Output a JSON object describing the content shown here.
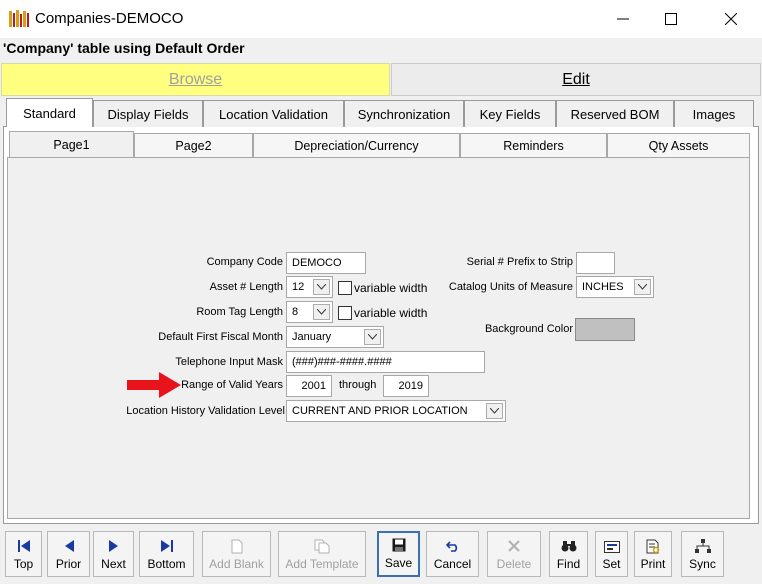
{
  "window": {
    "title": "Companies-DEMOCO",
    "minimize_icon": "minimize-icon",
    "maximize_icon": "maximize-icon",
    "close_icon": "close-icon"
  },
  "header": {
    "table_title": "'Company' table using Default Order"
  },
  "modes": {
    "browse": "Browse",
    "edit": "Edit"
  },
  "tabs": [
    "Standard",
    "Display Fields",
    "Location Validation",
    "Synchronization",
    "Key Fields",
    "Reserved BOM",
    "Images"
  ],
  "subtabs": [
    "Page1",
    "Page2",
    "Depreciation/Currency",
    "Reminders",
    "Qty Assets"
  ],
  "form": {
    "company_code": {
      "label": "Company Code",
      "value": "DEMOCO"
    },
    "asset_length": {
      "label": "Asset # Length",
      "value": "12",
      "checkbox_label": "variable width"
    },
    "room_tag_length": {
      "label": "Room Tag Length",
      "value": "8",
      "checkbox_label": "variable width"
    },
    "fiscal_month": {
      "label": "Default First Fiscal Month",
      "value": "January"
    },
    "phone_mask": {
      "label": "Telephone Input Mask",
      "value": "(###)###-####.####"
    },
    "valid_years": {
      "label": "Range of Valid Years",
      "from": "2001",
      "through_label": "through",
      "to": "2019"
    },
    "history_level": {
      "label": "Location History Validation Level",
      "value": "CURRENT AND PRIOR LOCATION"
    },
    "serial_prefix": {
      "label": "Serial # Prefix to Strip",
      "value": ""
    },
    "catalog_units": {
      "label": "Catalog Units of Measure",
      "value": "INCHES"
    },
    "background_color": {
      "label": "Background Color",
      "color": "#c0c0c0"
    }
  },
  "toolbar": {
    "top": "Top",
    "prior": "Prior",
    "next": "Next",
    "bottom": "Bottom",
    "add_blank": "Add Blank",
    "add_template": "Add Template",
    "save": "Save",
    "cancel": "Cancel",
    "delete": "Delete",
    "find": "Find",
    "set": "Set",
    "print": "Print",
    "sync": "Sync"
  },
  "colors": {
    "browse_bg": "#ffff80",
    "arrow": "#e8141c",
    "nav_blue": "#1a3aa0"
  }
}
